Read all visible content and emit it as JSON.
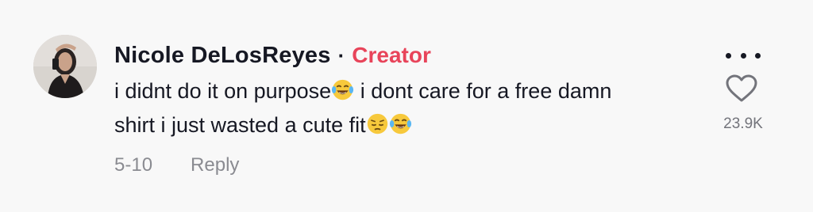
{
  "comment": {
    "author": "Nicole DeLosReyes",
    "separator": "·",
    "badge": "Creator",
    "text_line1_a": "i didnt do it on purpose",
    "text_line1_b": " i dont care for a free damn",
    "text_line2": "shirt i just wasted a cute fit",
    "emojis": [
      "face-with-tears-of-joy",
      "pensive-face",
      "face-with-tears-of-joy"
    ],
    "date": "5-10",
    "reply_label": "Reply",
    "like_count": "23.9K"
  },
  "colors": {
    "background": "#f8f8f8",
    "text": "#161823",
    "creator_badge": "#e8445a",
    "meta": "#8a8b91"
  },
  "icons": [
    "more-options-icon",
    "heart-icon"
  ]
}
